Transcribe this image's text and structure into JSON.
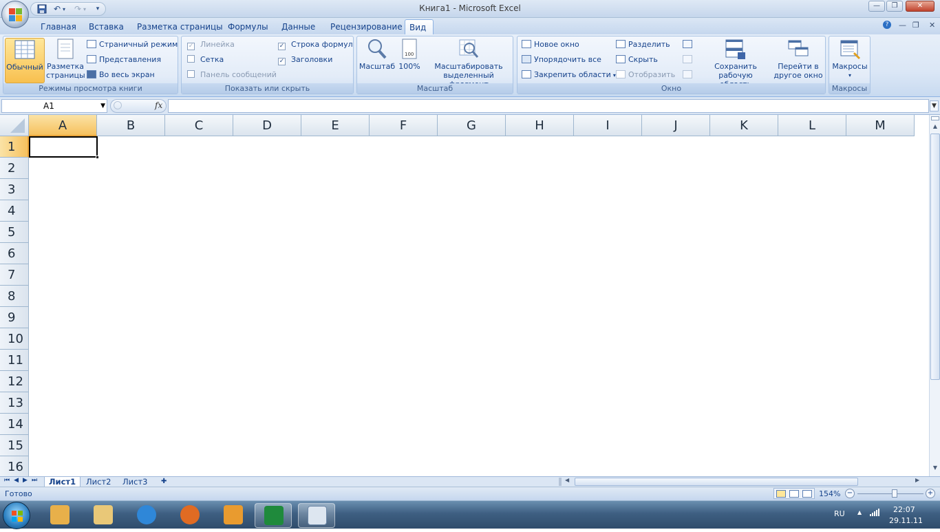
{
  "window": {
    "title": "Книга1 - Microsoft Excel",
    "min": "—",
    "max": "❐",
    "close": "✕"
  },
  "qat": {
    "save": "save-icon",
    "undo": "undo-icon",
    "redo": "redo-icon",
    "customize": "▾"
  },
  "tabs": [
    "Главная",
    "Вставка",
    "Разметка страницы",
    "Формулы",
    "Данные",
    "Рецензирование",
    "Вид"
  ],
  "active_tab": "Вид",
  "ribbon": {
    "views": {
      "label": "Режимы просмотра книги",
      "normal": "Обычный",
      "page_layout_1": "Разметка",
      "page_layout_2": "страницы",
      "page_break": "Страничный режим",
      "custom": "Представления",
      "fullscreen": "Во весь экран"
    },
    "show": {
      "label": "Показать или скрыть",
      "ruler": "Линейка",
      "grid": "Сетка",
      "msgbar": "Панель сообщений",
      "formula_bar": "Строка формул",
      "headings": "Заголовки"
    },
    "zoom": {
      "label": "Масштаб",
      "zoom": "Масштаб",
      "hundred": "100%",
      "sel_1": "Масштабировать",
      "sel_2": "выделенный фрагмент"
    },
    "window": {
      "label": "Окно",
      "new": "Новое окно",
      "arrange": "Упорядочить все",
      "freeze": "Закрепить области",
      "split": "Разделить",
      "hide": "Скрыть",
      "unhide": "Отобразить",
      "save_ws_1": "Сохранить",
      "save_ws_2": "рабочую область",
      "switch_1": "Перейти в",
      "switch_2": "другое окно"
    },
    "macros": {
      "label": "Макросы",
      "btn": "Макросы"
    }
  },
  "formula_bar": {
    "name_box": "A1",
    "fx": "fx",
    "value": ""
  },
  "columns": [
    "A",
    "B",
    "C",
    "D",
    "E",
    "F",
    "G",
    "H",
    "I",
    "J",
    "K",
    "L",
    "M"
  ],
  "rows": [
    "1",
    "2",
    "3",
    "4",
    "5",
    "6",
    "7",
    "8",
    "9",
    "10",
    "11",
    "12",
    "13",
    "14",
    "15",
    "16"
  ],
  "sheets": [
    "Лист1",
    "Лист2",
    "Лист3"
  ],
  "active_sheet": "Лист1",
  "status": {
    "ready": "Готово",
    "zoom": "154%"
  },
  "taskbar": {
    "lang": "RU",
    "time": "22:07",
    "date": "29.11.11"
  },
  "colors": {
    "accent": "#15428b",
    "selected_header": "#f6c15e",
    "ribbon": "#dbe7f6"
  }
}
